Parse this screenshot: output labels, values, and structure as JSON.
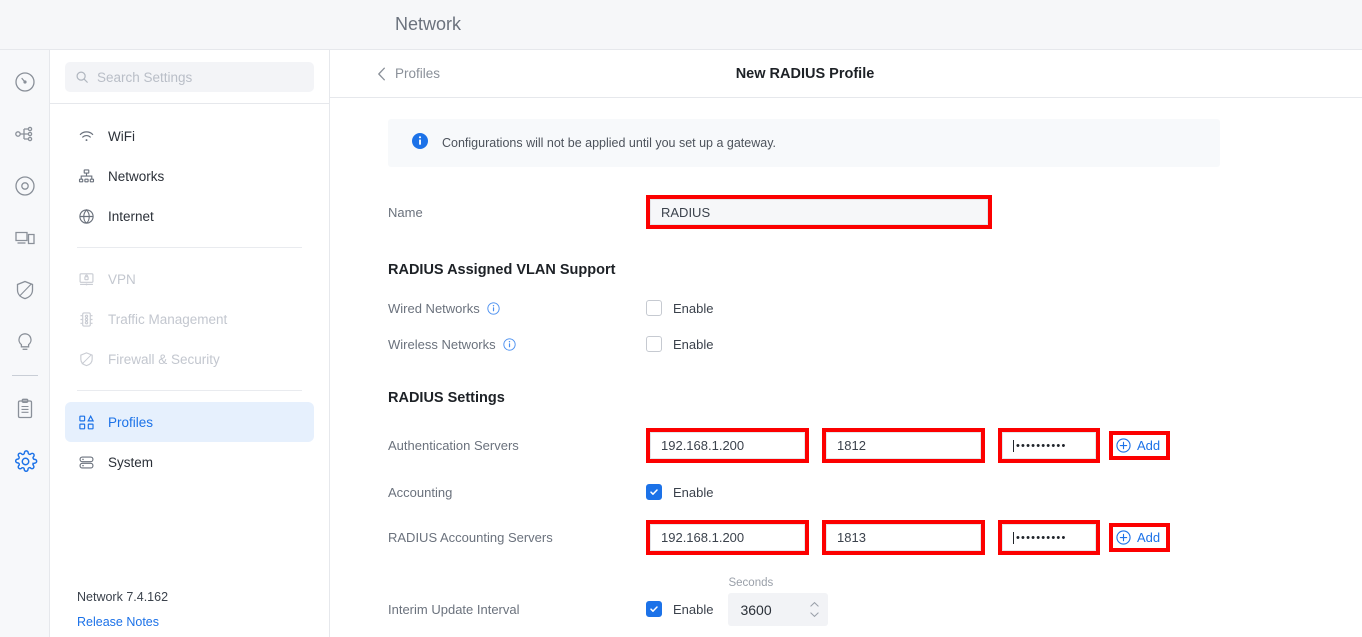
{
  "app": {
    "logo_icon": "unifi-logo-icon",
    "header_title": "Network"
  },
  "rail": {
    "items": [
      {
        "icon": "dashboard-speed-icon",
        "name": "rail-item-dashboard"
      },
      {
        "icon": "topology-icon",
        "name": "rail-item-topology"
      },
      {
        "icon": "target-circle-icon",
        "name": "rail-item-unifi-devices"
      },
      {
        "icon": "client-devices-icon",
        "name": "rail-item-client-devices"
      },
      {
        "icon": "shield-icon",
        "name": "rail-item-security"
      },
      {
        "icon": "insights-bulb-icon",
        "name": "rail-item-insights"
      },
      {
        "icon": "clipboard-logs-icon",
        "name": "rail-item-logs"
      },
      {
        "icon": "gear-icon",
        "name": "rail-item-settings",
        "active": true
      }
    ]
  },
  "sidebar": {
    "search": {
      "placeholder": "Search Settings",
      "value": ""
    },
    "groups": [
      {
        "items": [
          {
            "label": "WiFi",
            "icon": "wifi-icon",
            "state": "normal"
          },
          {
            "label": "Networks",
            "icon": "networks-icon",
            "state": "normal"
          },
          {
            "label": "Internet",
            "icon": "globe-icon",
            "state": "normal"
          }
        ]
      },
      {
        "items": [
          {
            "label": "VPN",
            "icon": "vpn-lock-icon",
            "state": "disabled"
          },
          {
            "label": "Traffic Management",
            "icon": "traffic-light-icon",
            "state": "disabled"
          },
          {
            "label": "Firewall & Security",
            "icon": "shield-icon",
            "state": "disabled"
          }
        ]
      },
      {
        "items": [
          {
            "label": "Profiles",
            "icon": "profiles-icon",
            "state": "active"
          },
          {
            "label": "System",
            "icon": "system-icon",
            "state": "normal"
          }
        ]
      }
    ],
    "version": "Network 7.4.162",
    "release_notes": "Release Notes"
  },
  "breadcrumb": {
    "back_icon": "chevron-left-icon",
    "back_label": "Profiles"
  },
  "page": {
    "title": "New RADIUS Profile"
  },
  "notice": {
    "icon": "info-icon",
    "text": "Configurations will not be applied until you set up a gateway."
  },
  "form": {
    "name": {
      "label": "Name",
      "value": "RADIUS",
      "highlighted": true
    },
    "vlan_section": {
      "title": "RADIUS Assigned VLAN Support",
      "rows": [
        {
          "label": "Wired Networks",
          "info_icon": "info-icon",
          "checkbox_label": "Enable",
          "checked": false
        },
        {
          "label": "Wireless Networks",
          "info_icon": "info-icon",
          "checkbox_label": "Enable",
          "checked": false
        }
      ]
    },
    "radius_section": {
      "title": "RADIUS Settings",
      "auth_servers": {
        "label": "Authentication Servers",
        "ip": "192.168.1.200",
        "port": "1812",
        "secret_masked": "••••••••••",
        "add_label": "Add",
        "add_icon": "plus-circle-icon"
      },
      "accounting": {
        "label": "Accounting",
        "checkbox_label": "Enable",
        "checked": true
      },
      "accounting_servers": {
        "label": "RADIUS Accounting Servers",
        "ip": "192.168.1.200",
        "port": "1813",
        "secret_masked": "••••••••••",
        "add_label": "Add",
        "add_icon": "plus-circle-icon"
      },
      "interim": {
        "label": "Interim Update Interval",
        "checkbox_label": "Enable",
        "checked": true,
        "units_label": "Seconds",
        "value": "3600"
      }
    }
  },
  "colors": {
    "accent": "#1c72e8",
    "highlight": "#fc0000",
    "notice_bg": "#f7f9fb",
    "sidebar_active_bg": "#e6f0fd"
  }
}
